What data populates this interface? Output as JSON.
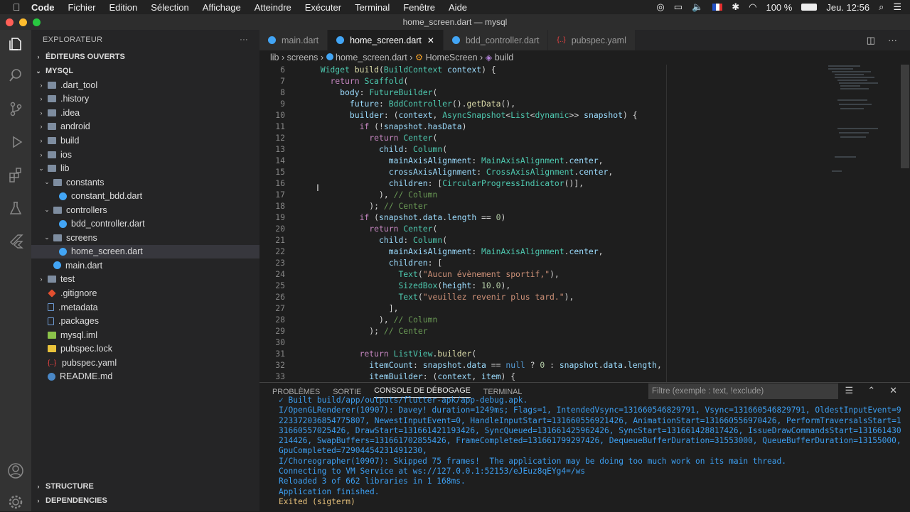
{
  "menubar": {
    "app": "Code",
    "items": [
      "Fichier",
      "Edition",
      "Sélection",
      "Affichage",
      "Atteindre",
      "Exécuter",
      "Terminal",
      "Fenêtre",
      "Aide"
    ],
    "battery": "100 %",
    "clock": "Jeu. 12:56"
  },
  "window": {
    "title": "home_screen.dart — mysql"
  },
  "explorer": {
    "header": "EXPLORATEUR",
    "more": "···",
    "open_editors": "ÉDITEURS OUVERTS",
    "root": "MYSQL",
    "rows": [
      {
        "label": ".dart_tool",
        "indent": 1,
        "chev": "›",
        "icon": "fold"
      },
      {
        "label": ".history",
        "indent": 1,
        "chev": "›",
        "icon": "fold"
      },
      {
        "label": ".idea",
        "indent": 1,
        "chev": "›",
        "icon": "fold"
      },
      {
        "label": "android",
        "indent": 1,
        "chev": "›",
        "icon": "fold"
      },
      {
        "label": "build",
        "indent": 1,
        "chev": "›",
        "icon": "fold"
      },
      {
        "label": "ios",
        "indent": 1,
        "chev": "›",
        "icon": "fold"
      },
      {
        "label": "lib",
        "indent": 1,
        "chev": "⌄",
        "icon": "fold"
      },
      {
        "label": "constants",
        "indent": 2,
        "chev": "⌄",
        "icon": "fold"
      },
      {
        "label": "constant_bdd.dart",
        "indent": 3,
        "chev": "",
        "icon": "dart"
      },
      {
        "label": "controllers",
        "indent": 2,
        "chev": "⌄",
        "icon": "fold"
      },
      {
        "label": "bdd_controller.dart",
        "indent": 3,
        "chev": "",
        "icon": "dart"
      },
      {
        "label": "screens",
        "indent": 2,
        "chev": "⌄",
        "icon": "fold"
      },
      {
        "label": "home_screen.dart",
        "indent": 3,
        "chev": "",
        "icon": "dart",
        "selected": true
      },
      {
        "label": "main.dart",
        "indent": 2,
        "chev": "",
        "icon": "dart"
      },
      {
        "label": "test",
        "indent": 1,
        "chev": "›",
        "icon": "fold"
      },
      {
        "label": ".gitignore",
        "indent": 1,
        "chev": "",
        "icon": "gi"
      },
      {
        "label": ".metadata",
        "indent": 1,
        "chev": "",
        "icon": "doc"
      },
      {
        "label": ".packages",
        "indent": 1,
        "chev": "",
        "icon": "doc"
      },
      {
        "label": "mysql.iml",
        "indent": 1,
        "chev": "",
        "icon": "xml"
      },
      {
        "label": "pubspec.lock",
        "indent": 1,
        "chev": "",
        "icon": "lock"
      },
      {
        "label": "pubspec.yaml",
        "indent": 1,
        "chev": "",
        "icon": "yaml"
      },
      {
        "label": "README.md",
        "indent": 1,
        "chev": "",
        "icon": "info"
      }
    ],
    "structure": "STRUCTURE",
    "dependencies": "DEPENDENCIES"
  },
  "tabs": [
    {
      "label": "main.dart"
    },
    {
      "label": "home_screen.dart",
      "active": true
    },
    {
      "label": "bdd_controller.dart"
    },
    {
      "label": "pubspec.yaml",
      "yaml": true
    }
  ],
  "breadcrumb": {
    "a": "lib",
    "b": "screens",
    "c": "home_screen.dart",
    "d": "HomeScreen",
    "e": "build"
  },
  "code_start": 6,
  "code": [
    "  <span class='ty'>Widget</span> <span class='fn'>build</span>(<span class='ty'>BuildContext</span> <span class='vr'>context</span>) {",
    "    <span class='kw'>return</span> <span class='ty'>Scaffold</span>(",
    "      <span class='vr'>body</span>: <span class='ty'>FutureBuilder</span>(",
    "        <span class='vr'>future</span>: <span class='ty'>BddController</span>().<span class='fn'>getData</span>(),",
    "        <span class='vr'>builder</span>: (<span class='vr'>context</span>, <span class='ty'>AsyncSnapshot</span>&lt;<span class='ty'>List</span>&lt;<span class='ty'>dynamic</span>&gt;&gt; <span class='vr'>snapshot</span>) {",
    "          <span class='kw'>if</span> (!<span class='vr'>snapshot</span>.<span class='vr'>hasData</span>)",
    "            <span class='kw'>return</span> <span class='ty'>Center</span>(",
    "              <span class='vr'>child</span>: <span class='ty'>Column</span>(",
    "                <span class='vr'>mainAxisAlignment</span>: <span class='ty'>MainAxisAlignment</span>.<span class='vr'>center</span>,",
    "                <span class='vr'>crossAxisAlignment</span>: <span class='ty'>CrossAxisAlignment</span>.<span class='vr'>center</span>,",
    "                <span class='vr'>children</span>: [<span class='ty'>CircularProgressIndicator</span>()],",
    "              ), <span class='cm'>// Column</span>",
    "            ); <span class='cm'>// Center</span>",
    "          <span class='kw'>if</span> (<span class='vr'>snapshot</span>.<span class='vr'>data</span>.<span class='vr'>length</span> == <span class='nm'>0</span>)",
    "            <span class='kw'>return</span> <span class='ty'>Center</span>(",
    "              <span class='vr'>child</span>: <span class='ty'>Column</span>(",
    "                <span class='vr'>mainAxisAlignment</span>: <span class='ty'>MainAxisAlignment</span>.<span class='vr'>center</span>,",
    "                <span class='vr'>children</span>: [",
    "                  <span class='ty'>Text</span>(<span class='st'>\"Aucun évènement sportif,\"</span>),",
    "                  <span class='ty'>SizedBox</span>(<span class='vr'>height</span>: <span class='nm'>10.0</span>),",
    "                  <span class='ty'>Text</span>(<span class='st'>\"veuillez revenir plus tard.\"</span>),",
    "                ],",
    "              ), <span class='cm'>// Column</span>",
    "            ); <span class='cm'>// Center</span>",
    "",
    "          <span class='kw'>return</span> <span class='ty'>ListView</span>.<span class='fn'>builder</span>(",
    "            <span class='vr'>itemCount</span>: <span class='vr'>snapshot</span>.<span class='vr'>data</span> == <span class='bl'>null</span> ? <span class='nm'>0</span> : <span class='vr'>snapshot</span>.<span class='vr'>data</span>.<span class='vr'>length</span>,",
    "            <span class='vr'>itemBuilder</span>: (<span class='vr'>context</span>, <span class='vr'>item</span>) {"
  ],
  "panel": {
    "tabs": [
      "PROBLÈMES",
      "SORTIE",
      "CONSOLE DE DÉBOGAGE",
      "TERMINAL"
    ],
    "active": 2,
    "filter_placeholder": "Filtre (exemple : text, !exclude)",
    "lines": [
      "✓ Built build/app/outputs/flutter-apk/app-debug.apk.",
      "I/OpenGLRenderer(10907): Davey! duration=1249ms; Flags=1, IntendedVsync=131660546829791, Vsync=131660546829791, OldestInputEvent=9223372036854775807, NewestInputEvent=0, HandleInputStart=131660556921426, AnimationStart=131660556970426, PerformTraversalsStart=131660557025426, DrawStart=131661421193426, SyncQueued=131661425962426, SyncStart=131661428817426, IssueDrawCommandsStart=131661430214426, SwapBuffers=131661702855426, FrameCompleted=131661799297426, DequeueBufferDuration=31553000, QueueBufferDuration=13155000, GpuCompleted=72904454231491230,",
      "I/Choreographer(10907): Skipped 75 frames!  The application may be doing too much work on its main thread.",
      "Connecting to VM Service at ws://127.0.0.1:52153/eJEuz8qEYg4=/ws",
      "Reloaded 3 of 662 libraries in 1 168ms.",
      "Application finished.",
      "Exited (sigterm)"
    ]
  }
}
